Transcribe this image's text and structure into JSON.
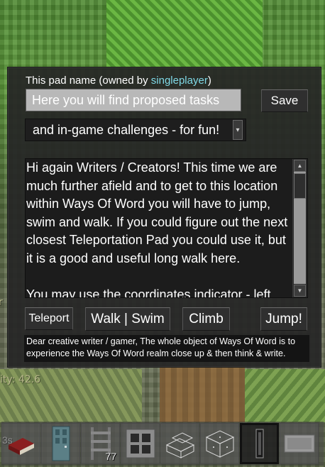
{
  "world": {
    "left_edge_letter": "r",
    "stat_text": "ity: 42.6"
  },
  "dialog": {
    "pad_label_prefix": "This pad name (owned by ",
    "owner": "singleplayer",
    "pad_label_suffix": ")",
    "name_value": "Here you will find proposed tasks",
    "save_label": "Save",
    "select_value": "and in-game challenges - for fun!",
    "description_paragraphs": [
      "Hi again Writers / Creators! This time we are much further afield and to get to this location within Ways Of Word you will have to jump, swim and walk. If you could figure out the next closest Teleportation Pad you could use it, but it is a good and useful long walk here.",
      "You may use the coordinates indicator - left."
    ],
    "buttons": {
      "teleport": "Teleport",
      "walk_swim": "Walk | Swim",
      "climb": "Climb",
      "jump": "Jump!"
    },
    "footer_note": "Dear creative writer / gamer, The whole object of Ways Of Word is to experience the Ways Of Word realm close up & then think & write."
  },
  "hotbar": {
    "left_count": "3s",
    "slots": [
      {
        "icon": "book-icon",
        "count": ""
      },
      {
        "icon": "door-icon",
        "count": ""
      },
      {
        "icon": "ladder-icon",
        "count": "77"
      },
      {
        "icon": "window-icon",
        "count": ""
      },
      {
        "icon": "glass-stairs-icon",
        "count": ""
      },
      {
        "icon": "glass-block-icon",
        "count": ""
      },
      {
        "icon": "teleport-pad-icon",
        "count": "",
        "selected": true
      },
      {
        "icon": "stone-slab-icon",
        "count": ""
      }
    ]
  },
  "colors": {
    "owner_name": "#7fd8e6",
    "dialog_bg": "#262626",
    "input_bg": "#b8b8b8"
  }
}
